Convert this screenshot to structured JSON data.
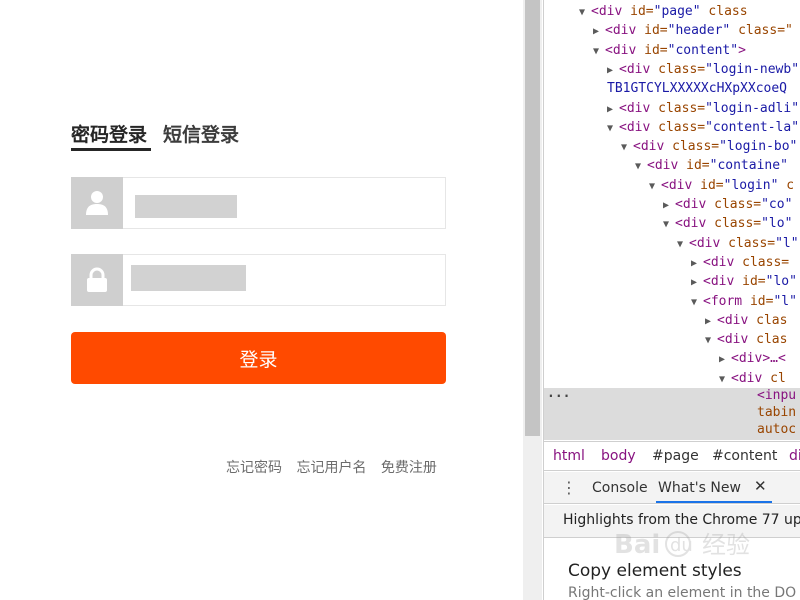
{
  "login": {
    "tabs": [
      {
        "label": "密码登录",
        "active": true
      },
      {
        "label": "短信登录",
        "active": false
      }
    ],
    "username_icon": "user-icon",
    "password_icon": "lock-icon",
    "submit_label": "登录",
    "submit_color": "#ff4a00",
    "footer_links": [
      "忘记密码",
      "忘记用户名",
      "免费注册"
    ]
  },
  "devtools": {
    "tree": [
      {
        "arrow": "▼",
        "tag": "div",
        "attr": "id",
        "val": "page",
        "attr2": "class"
      },
      {
        "arrow": "▶",
        "tag": "div",
        "attr": "id",
        "val": "header",
        "attr2": "class=\""
      },
      {
        "arrow": "▼",
        "tag": "div",
        "attr": "id",
        "val": "content",
        "close": ">"
      },
      {
        "arrow": "▶",
        "tag": "div",
        "attr": "class",
        "val": "login-newb"
      },
      {
        "arrow": "",
        "text": "TB1GTCYLXXXXXcHXpXXcoeQ"
      },
      {
        "arrow": "▶",
        "tag": "div",
        "attr": "class",
        "val": "login-adli"
      },
      {
        "arrow": "▼",
        "tag": "div",
        "attr": "class",
        "val": "content-la"
      },
      {
        "arrow": "▼",
        "tag": "div",
        "attr": "class",
        "val": "login-bo"
      },
      {
        "arrow": "▼",
        "tag": "div",
        "attr": "id",
        "val": "containe"
      },
      {
        "arrow": "▼",
        "tag": "div",
        "attr": "id",
        "val": "login",
        "tail": "c"
      },
      {
        "arrow": "▶",
        "tag": "div",
        "attr": "class",
        "val": "co"
      },
      {
        "arrow": "▼",
        "tag": "div",
        "attr": "class",
        "val": "lo"
      },
      {
        "arrow": "▼",
        "tag": "div",
        "attr": "class",
        "val": "l"
      },
      {
        "arrow": "▶",
        "tag": "div",
        "attr": "class="
      },
      {
        "arrow": "▶",
        "tag": "div",
        "attr": "id",
        "val": "lo"
      },
      {
        "arrow": "▼",
        "tag": "form",
        "attr": "id",
        "val": "l"
      },
      {
        "arrow": "▶",
        "tag": "div",
        "attr": "clas"
      },
      {
        "arrow": "▼",
        "tag": "div",
        "attr": "clas"
      },
      {
        "arrow": "▶",
        "tag": "div",
        "close": ">…<"
      },
      {
        "arrow": "▼",
        "tag": "div",
        "attr": "cl"
      }
    ],
    "selected": {
      "ellipsis": "...",
      "line1": "<inpu",
      "line2": "tabin",
      "line3": "autoc"
    },
    "breadcrumb": [
      "html",
      "body",
      "#page",
      "#content",
      "di"
    ],
    "drawer": {
      "menu_icon": "kebab-menu-icon",
      "tabs": [
        "Console",
        "What's New"
      ],
      "close_icon": "close-icon"
    },
    "whatsnew": {
      "highlights": "Highlights from the Chrome 77 upd",
      "title": "Copy element styles",
      "desc": "Right-click an element in the DO"
    }
  },
  "watermark": {
    "text": "Bai 经验"
  }
}
